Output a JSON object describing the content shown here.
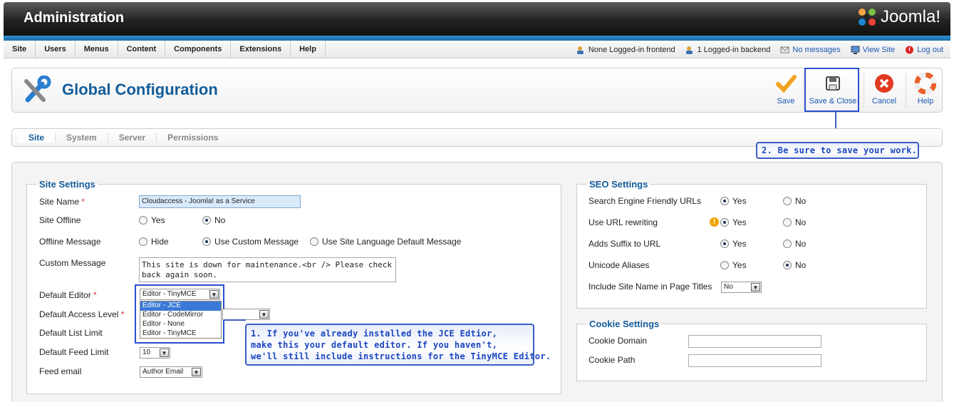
{
  "header": {
    "title": "Administration",
    "logo_text": "Joomla!"
  },
  "menu": [
    "Site",
    "Users",
    "Menus",
    "Content",
    "Components",
    "Extensions",
    "Help"
  ],
  "status": {
    "frontend": "None Logged-in frontend",
    "backend": "1 Logged-in backend",
    "messages": "No messages",
    "view_site": "View Site",
    "logout": "Log out"
  },
  "toolbar": {
    "title": "Global Configuration",
    "save": "Save",
    "save_close": "Save & Close",
    "cancel": "Cancel",
    "help": "Help"
  },
  "tabs": [
    "Site",
    "System",
    "Server",
    "Permissions"
  ],
  "callouts": {
    "save": "2. Be sure to save your work.",
    "editor": [
      "1. If you've already installed the JCE Edtior,",
      "make this your default editor. If you haven't,",
      "we'll still include instructions for the TinyMCE Editor."
    ]
  },
  "site_settings": {
    "legend": "Site Settings",
    "site_name_label": "Site Name",
    "site_name_value": "Cloudaccess - Joomla! as a Service",
    "site_offline_label": "Site Offline",
    "site_offline_options": [
      "Yes",
      "No"
    ],
    "site_offline_selected": "No",
    "offline_message_label": "Offline Message",
    "offline_message_options": [
      "Hide",
      "Use Custom Message",
      "Use Site Language Default Message"
    ],
    "offline_message_selected": "Use Custom Message",
    "custom_message_label": "Custom Message",
    "custom_message_value": "This site is down for maintenance.<br /> Please check back again soon.",
    "default_editor_label": "Default Editor",
    "default_editor_value": "Editor - TinyMCE",
    "editor_options": [
      "Editor - JCE",
      "Editor - CodeMirror",
      "Editor - None",
      "Editor - TinyMCE"
    ],
    "editor_highlighted": "Editor - JCE",
    "default_access_label": "Default Access Level",
    "default_list_label": "Default List Limit",
    "default_feed_label": "Default Feed Limit",
    "default_feed_value": "10",
    "feed_email_label": "Feed email",
    "feed_email_value": "Author Email",
    "required_mark": "*"
  },
  "seo_settings": {
    "legend": "SEO Settings",
    "rows": [
      {
        "label": "Search Engine Friendly URLs",
        "selected": "Yes"
      },
      {
        "label": "Use URL rewriting",
        "selected": "Yes"
      },
      {
        "label": "Adds Suffix to URL",
        "selected": "Yes"
      },
      {
        "label": "Unicode Aliases",
        "selected": "No"
      }
    ],
    "yes": "Yes",
    "no": "No",
    "include_site_name_label": "Include Site Name in Page Titles",
    "include_site_name_value": "No"
  },
  "cookie_settings": {
    "legend": "Cookie Settings",
    "domain_label": "Cookie Domain",
    "domain_value": "",
    "path_label": "Cookie Path",
    "path_value": ""
  },
  "colors": {
    "accent": "#135c9a",
    "callout_border": "#3d5fc4",
    "header_blue": "#1a6ea8"
  }
}
